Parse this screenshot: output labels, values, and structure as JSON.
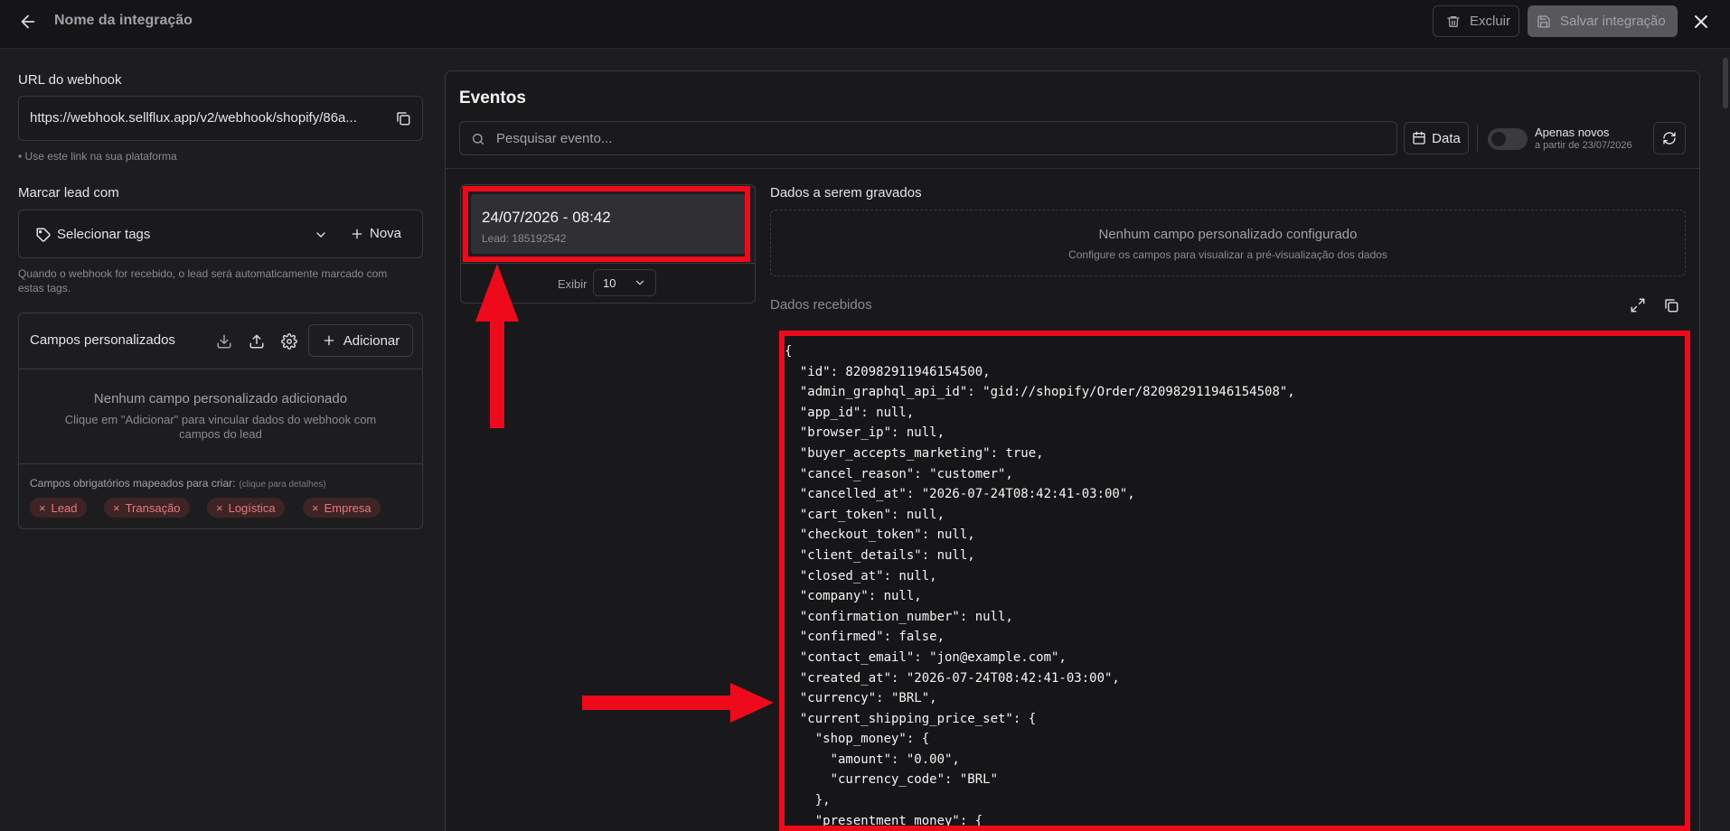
{
  "header": {
    "title": "Nome da integração",
    "delete_label": "Excluir",
    "save_label": "Salvar integração"
  },
  "sidebar": {
    "webhook_label": "URL do webhook",
    "webhook_url": "https://webhook.sellflux.app/v2/webhook/shopify/86a...",
    "webhook_hint": "• Use este link na sua plataforma",
    "mark_lead_label": "Marcar lead com",
    "select_tags_label": "Selecionar tags",
    "new_tag_label": "Nova",
    "mark_lead_hint": "Quando o webhook for recebido, o lead será automaticamente marcado com estas tags.",
    "custom_fields": {
      "title": "Campos personalizados",
      "add_label": "Adicionar",
      "empty_title": "Nenhum campo personalizado adicionado",
      "empty_subtitle": "Clique em \"Adicionar\" para vincular dados do webhook com campos do lead",
      "required_label": "Campos obrigatórios mapeados para criar:",
      "required_hint": "(clique para detalhes)",
      "chips": [
        "Lead",
        "Transação",
        "Logística",
        "Empresa"
      ]
    }
  },
  "events": {
    "title": "Eventos",
    "search_placeholder": "Pesquisar evento...",
    "date_button": "Data",
    "only_new_label": "Apenas novos",
    "only_new_sub": "a partir de 23/07/2026",
    "only_new_enabled": false,
    "list": [
      {
        "date": "24/07/2026 - 08:42",
        "lead": "Lead: 185192542"
      }
    ],
    "show_label": "Exibir",
    "show_value": "10",
    "data_to_save_label": "Dados a serem gravados",
    "no_field_title": "Nenhum campo personalizado configurado",
    "no_field_subtitle": "Configure os campos para visualizar a pré-visualização dos dados",
    "received_label": "Dados recebidos",
    "json_lines": [
      "{",
      "  \"id\": 820982911946154500,",
      "  \"admin_graphql_api_id\": \"gid://shopify/Order/820982911946154508\",",
      "  \"app_id\": null,",
      "  \"browser_ip\": null,",
      "  \"buyer_accepts_marketing\": true,",
      "  \"cancel_reason\": \"customer\",",
      "  \"cancelled_at\": \"2026-07-24T08:42:41-03:00\",",
      "  \"cart_token\": null,",
      "  \"checkout_token\": null,",
      "  \"client_details\": null,",
      "  \"closed_at\": null,",
      "  \"company\": null,",
      "  \"confirmation_number\": null,",
      "  \"confirmed\": false,",
      "  \"contact_email\": \"jon@example.com\",",
      "  \"created_at\": \"2026-07-24T08:42:41-03:00\",",
      "  \"currency\": \"BRL\",",
      "  \"current_shipping_price_set\": {",
      "    \"shop_money\": {",
      "      \"amount\": \"0.00\",",
      "      \"currency_code\": \"BRL\"",
      "    },",
      "    \"presentment_money\": {"
    ]
  },
  "colors": {
    "background": "#1d1d20",
    "topbar": "#151517",
    "annotation_red": "#ee0a1a",
    "chip_text": "#e07a7f",
    "chip_bg": "#3f2426"
  }
}
